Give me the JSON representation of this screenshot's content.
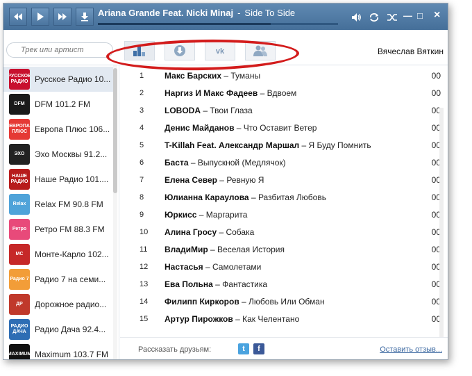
{
  "player": {
    "artist": "Ariana Grande Feat. Nicki Minaj",
    "separator": "-",
    "title": "Side To Side",
    "progress": 0.72,
    "window_buttons": {
      "minimize": "—",
      "restore": "□",
      "close": "×"
    }
  },
  "search": {
    "placeholder": "Трек или артист"
  },
  "tabs": [
    {
      "icon": "chart-icon",
      "active": true
    },
    {
      "icon": "download-icon",
      "active": false
    },
    {
      "icon": "vk-icon",
      "active": false
    },
    {
      "icon": "friends-icon",
      "active": false
    }
  ],
  "user": {
    "name": "Вячеслав Вяткин"
  },
  "stations": [
    {
      "name": "Русское Радио 10...",
      "logo_text": "РУССКОЕ РАДИО",
      "logo_bg": "#c8102e",
      "selected": true
    },
    {
      "name": "DFM 101.2 FM",
      "logo_text": "DFM",
      "logo_bg": "#1a1a1a",
      "selected": false
    },
    {
      "name": "Европа Плюс 106...",
      "logo_text": "ЕВРОПА ПЛЮС",
      "logo_bg": "#e53935",
      "selected": false
    },
    {
      "name": "Эхо Москвы 91.2...",
      "logo_text": "ЭХО",
      "logo_bg": "#222222",
      "selected": false
    },
    {
      "name": "Наше Радио 101....",
      "logo_text": "НАШЕ РАДИО",
      "logo_bg": "#b71c1c",
      "selected": false
    },
    {
      "name": "Relax FM 90.8 FM",
      "logo_text": "Relax",
      "logo_bg": "#4fa3d9",
      "selected": false
    },
    {
      "name": "Ретро FM 88.3 FM",
      "logo_text": "Ретро",
      "logo_bg": "#e84a7a",
      "selected": false
    },
    {
      "name": "Монте-Карло 102...",
      "logo_text": "MC",
      "logo_bg": "#c62828",
      "selected": false
    },
    {
      "name": "Радио 7 на семи...",
      "logo_text": "Радио 7",
      "logo_bg": "#f29d38",
      "selected": false
    },
    {
      "name": "Дорожное радио...",
      "logo_text": "ДР",
      "logo_bg": "#c0392b",
      "selected": false
    },
    {
      "name": "Радио Дача 92.4...",
      "logo_text": "РАДИО ДАЧА",
      "logo_bg": "#2e6db4",
      "selected": false
    },
    {
      "name": "Maximum 103.7 FM",
      "logo_text": "MAXIMUM",
      "logo_bg": "#111111",
      "selected": false
    }
  ],
  "tracks": [
    {
      "num": "1",
      "artist": "Макс Барских",
      "song": "Туманы",
      "duration": "00"
    },
    {
      "num": "2",
      "artist": "Наргиз И Макс Фадеев",
      "song": "Вдвоем",
      "duration": "00"
    },
    {
      "num": "3",
      "artist": "LOBODA",
      "song": "Твои Глаза",
      "duration": "00"
    },
    {
      "num": "4",
      "artist": "Денис Майданов",
      "song": "Что Оставит Ветер",
      "duration": "00"
    },
    {
      "num": "5",
      "artist": "T-Killah Feat. Александр Маршал",
      "song": "Я Буду Помнить",
      "duration": "00"
    },
    {
      "num": "6",
      "artist": "Баста",
      "song": "Выпускной (Медлячок)",
      "duration": "00"
    },
    {
      "num": "7",
      "artist": "Елена Север",
      "song": "Ревную Я",
      "duration": "00"
    },
    {
      "num": "8",
      "artist": "Юлианна Караулова",
      "song": "Разбитая Любовь",
      "duration": "00"
    },
    {
      "num": "9",
      "artist": "Юркисс",
      "song": "Маргарита",
      "duration": "00"
    },
    {
      "num": "10",
      "artist": "Алина Гросу",
      "song": "Собака",
      "duration": "00"
    },
    {
      "num": "11",
      "artist": "ВладиМир",
      "song": "Веселая История",
      "duration": "00"
    },
    {
      "num": "12",
      "artist": "Настасья",
      "song": "Самолетами",
      "duration": "00"
    },
    {
      "num": "13",
      "artist": "Ева Польна",
      "song": "Фантастика",
      "duration": "00"
    },
    {
      "num": "14",
      "artist": "Филипп Киркоров",
      "song": "Любовь Или Обман",
      "duration": "00"
    },
    {
      "num": "15",
      "artist": "Артур Пирожков",
      "song": "Как Челентано",
      "duration": "00"
    }
  ],
  "footer": {
    "share_label": "Рассказать друзьям:",
    "twitter": "t",
    "facebook": "f",
    "feedback": "Оставить отзыв..."
  },
  "colors": {
    "accent": "#4d77a0",
    "highlight_oval": "#d31c1c",
    "selected_row": "#e2e9f1"
  }
}
